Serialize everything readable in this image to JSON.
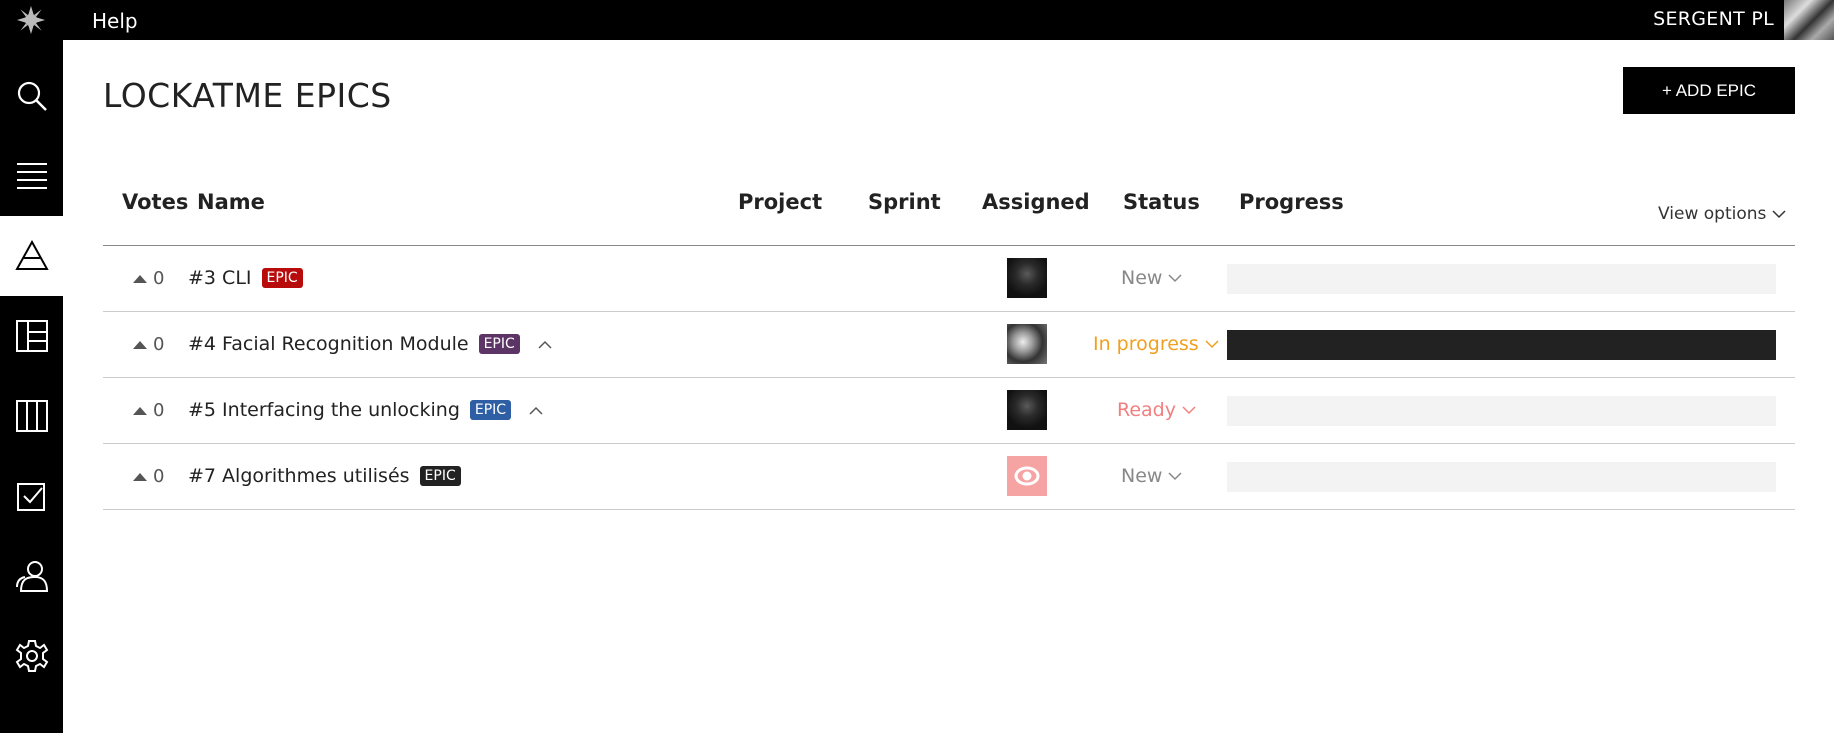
{
  "topbar": {
    "help_label": "Help",
    "user_name": "SERGENT PL"
  },
  "sidebar": {
    "items": [
      {
        "icon": "search-icon"
      },
      {
        "icon": "menu-icon"
      },
      {
        "icon": "epics-icon",
        "active": true
      },
      {
        "icon": "kanban-icon"
      },
      {
        "icon": "columns-icon"
      },
      {
        "icon": "issues-icon"
      },
      {
        "icon": "team-icon"
      },
      {
        "icon": "settings-icon"
      }
    ]
  },
  "page": {
    "title": "LOCKATME EPICS",
    "add_button_label": "+ ADD EPIC",
    "view_options_label": "View options"
  },
  "table": {
    "headers": {
      "votes": "Votes",
      "name": "Name",
      "project": "Project",
      "sprint": "Sprint",
      "assigned": "Assigned",
      "status": "Status",
      "progress": "Progress"
    },
    "rows": [
      {
        "votes": "0",
        "name": "#3 CLI",
        "tag": "EPIC",
        "tag_color": "#b80c0c",
        "collapsible": false,
        "avatar": "dark",
        "status": "New",
        "status_color": "#888888",
        "progress": 0
      },
      {
        "votes": "0",
        "name": "#4 Facial Recognition Module",
        "tag": "EPIC",
        "tag_color": "#5c3566",
        "collapsible": true,
        "avatar": "face",
        "status": "In progress",
        "status_color": "#f0a020",
        "progress": 1.0
      },
      {
        "votes": "0",
        "name": "#5 Interfacing the unlocking",
        "tag": "EPIC",
        "tag_color": "#2e5ea3",
        "collapsible": true,
        "avatar": "dark",
        "status": "Ready",
        "status_color": "#f08080",
        "progress": 0
      },
      {
        "votes": "0",
        "name": "#7 Algorithmes utilisés",
        "tag": "EPIC",
        "tag_color": "#222222",
        "collapsible": false,
        "avatar": "pink",
        "status": "New",
        "status_color": "#888888",
        "progress": 0
      }
    ]
  }
}
